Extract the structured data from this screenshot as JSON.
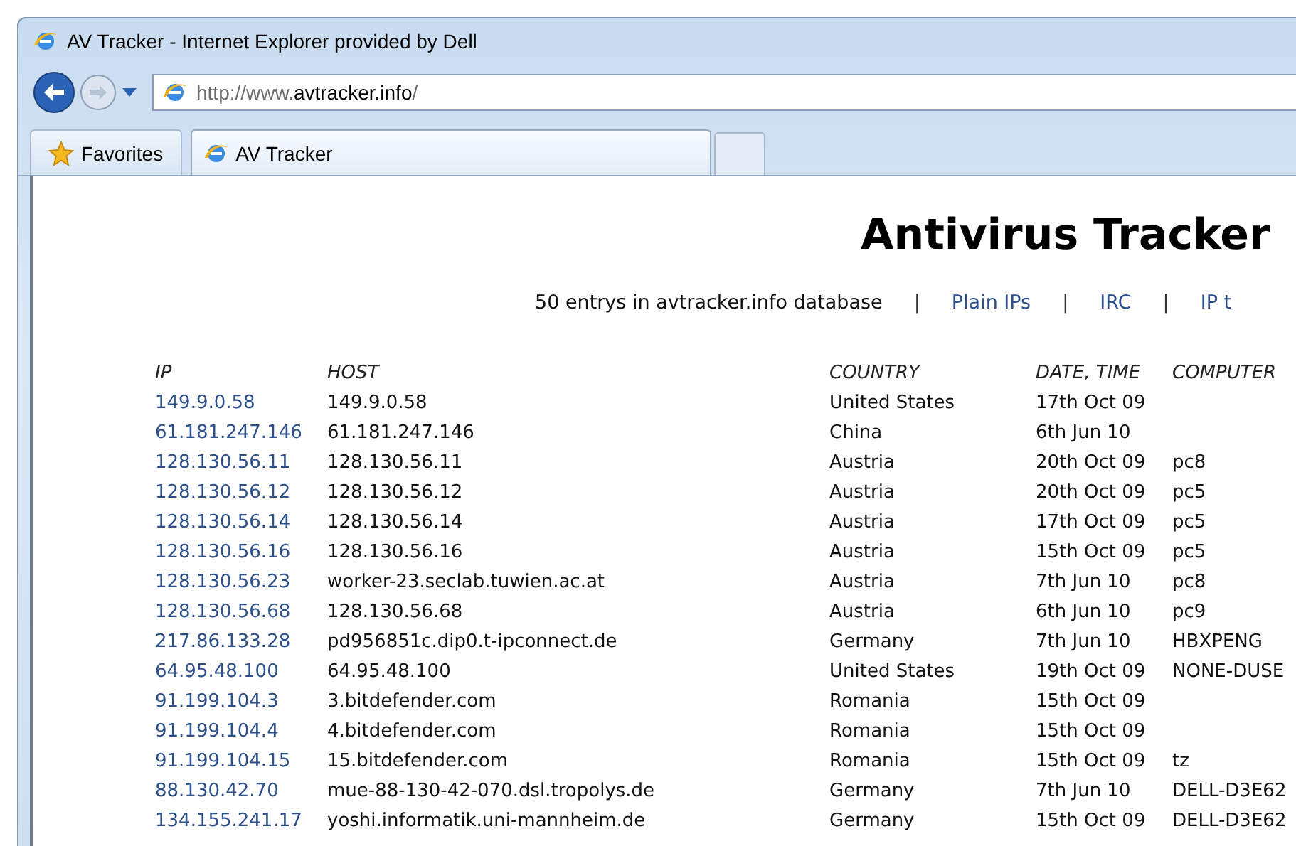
{
  "window": {
    "title": "AV Tracker - Internet Explorer provided by Dell"
  },
  "address_bar": {
    "prefix": "http://www.",
    "domain": "avtracker.info",
    "suffix": "/"
  },
  "favorites": {
    "label": "Favorites"
  },
  "tabs": [
    {
      "label": "AV Tracker",
      "selected": true
    }
  ],
  "page": {
    "heading": "Antivirus Tracker",
    "nav": [
      {
        "kind": "text",
        "label": "50 entrys in avtracker.info database"
      },
      {
        "kind": "separator",
        "label": "|"
      },
      {
        "kind": "link",
        "label": "Plain IPs"
      },
      {
        "kind": "separator",
        "label": "|"
      },
      {
        "kind": "link",
        "label": "IRC"
      },
      {
        "kind": "separator",
        "label": "|"
      },
      {
        "kind": "link",
        "label": "IP t"
      }
    ]
  },
  "table": {
    "columns": [
      "IP",
      "HOST",
      "COUNTRY",
      "DATE, TIME",
      "COMPUTER"
    ],
    "rows": [
      [
        "149.9.0.58",
        "149.9.0.58",
        "United States",
        "17th Oct 09",
        ""
      ],
      [
        "61.181.247.146",
        "61.181.247.146",
        "China",
        "6th Jun 10",
        ""
      ],
      [
        "128.130.56.11",
        "128.130.56.11",
        "Austria",
        "20th Oct 09",
        "pc8"
      ],
      [
        "128.130.56.12",
        "128.130.56.12",
        "Austria",
        "20th Oct 09",
        "pc5"
      ],
      [
        "128.130.56.14",
        "128.130.56.14",
        "Austria",
        "17th Oct 09",
        "pc5"
      ],
      [
        "128.130.56.16",
        "128.130.56.16",
        "Austria",
        "15th Oct 09",
        "pc5"
      ],
      [
        "128.130.56.23",
        "worker-23.seclab.tuwien.ac.at",
        "Austria",
        "7th Jun 10",
        "pc8"
      ],
      [
        "128.130.56.68",
        "128.130.56.68",
        "Austria",
        "6th Jun 10",
        "pc9"
      ],
      [
        "217.86.133.28",
        "pd956851c.dip0.t-ipconnect.de",
        "Germany",
        "7th Jun 10",
        "HBXPENG"
      ],
      [
        "64.95.48.100",
        "64.95.48.100",
        "United States",
        "19th Oct 09",
        "NONE-DUSE"
      ],
      [
        "91.199.104.3",
        "3.bitdefender.com",
        "Romania",
        "15th Oct 09",
        ""
      ],
      [
        "91.199.104.4",
        "4.bitdefender.com",
        "Romania",
        "15th Oct 09",
        ""
      ],
      [
        "91.199.104.15",
        "15.bitdefender.com",
        "Romania",
        "15th Oct 09",
        "tz"
      ],
      [
        "88.130.42.70",
        "mue-88-130-42-070.dsl.tropolys.de",
        "Germany",
        "7th Jun 10",
        "DELL-D3E62"
      ],
      [
        "134.155.241.17",
        "yoshi.informatik.uni-mannheim.de",
        "Germany",
        "15th Oct 09",
        "DELL-D3E62"
      ]
    ]
  }
}
